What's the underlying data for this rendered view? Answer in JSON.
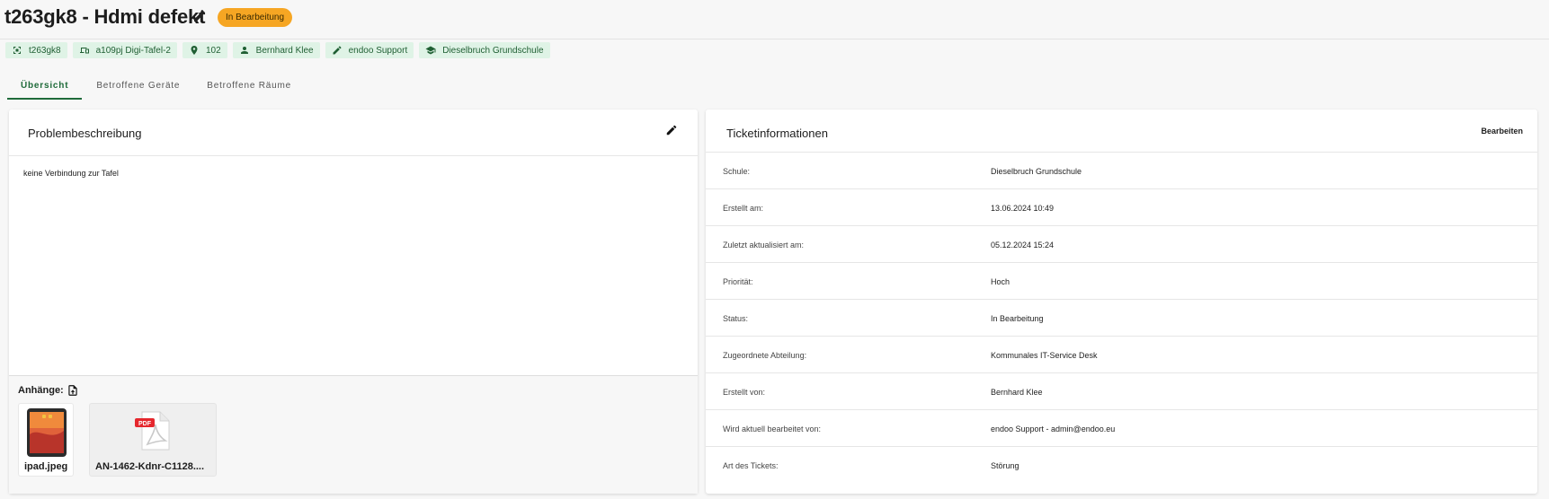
{
  "header": {
    "title": "t263gk8 - Hdmi defekt",
    "status": "In Bearbeitung",
    "status_color": "#f6a623"
  },
  "chips": [
    {
      "icon": "ticket-id-icon",
      "label": "t263gk8"
    },
    {
      "icon": "device-icon",
      "label": "a109pj Digi-Tafel-2"
    },
    {
      "icon": "location-pin-icon",
      "label": "102"
    },
    {
      "icon": "person-icon",
      "label": "Bernhard Klee"
    },
    {
      "icon": "pencil-icon",
      "label": "endoo Support"
    },
    {
      "icon": "school-icon",
      "label": "Dieselbruch Grundschule"
    }
  ],
  "tabs": [
    {
      "label": "Übersicht",
      "active": true
    },
    {
      "label": "Betroffene Geräte",
      "active": false
    },
    {
      "label": "Betroffene Räume",
      "active": false
    }
  ],
  "problem": {
    "title": "Problembeschreibung",
    "text": "keine Verbindung zur Tafel",
    "attachments_label": "Anhänge:",
    "attachments": [
      {
        "name": "ipad.jpeg",
        "icon": "image-thumbnail-icon"
      },
      {
        "name": "AN-1462-Kdnr-C1128....",
        "icon": "pdf-file-icon"
      }
    ]
  },
  "ticket_info": {
    "title": "Ticketinformationen",
    "edit_label": "Bearbeiten",
    "rows": [
      {
        "key": "Schule:",
        "value": "Dieselbruch Grundschule"
      },
      {
        "key": "Erstellt am:",
        "value": "13.06.2024 10:49"
      },
      {
        "key": "Zuletzt aktualisiert am:",
        "value": "05.12.2024 15:24"
      },
      {
        "key": "Priorität:",
        "value": "Hoch"
      },
      {
        "key": "Status:",
        "value": "In Bearbeitung"
      },
      {
        "key": "Zugeordnete Abteilung:",
        "value": "Kommunales IT-Service Desk"
      },
      {
        "key": "Erstellt von:",
        "value": "Bernhard Klee"
      },
      {
        "key": "Wird aktuell bearbeitet von:",
        "value": "endoo Support - admin@endoo.eu"
      },
      {
        "key": "Art des Tickets:",
        "value": "Störung"
      }
    ]
  },
  "colors": {
    "accent": "#1f6b3a",
    "chip_bg": "#dff3e6",
    "chip_text": "#1f5f33"
  }
}
